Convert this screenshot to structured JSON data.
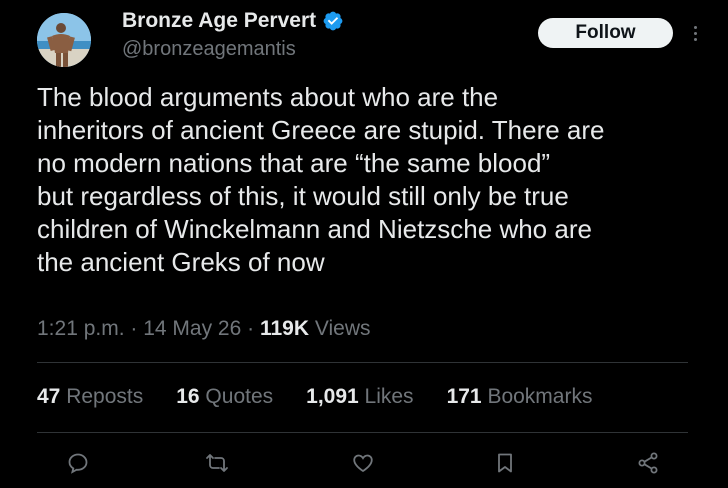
{
  "author": {
    "display_name": "Bronze Age Pervert",
    "handle": "@bronzeagemantis",
    "avatar_icon": "avatar-photo",
    "verified_icon": "verified-badge-icon",
    "verified_color": "#1d9bf0"
  },
  "header": {
    "follow_label": "Follow",
    "more_icon": "more-vertical-icon"
  },
  "tweet": {
    "text": "The blood arguments about who are the\ninheritors of ancient Greece are stupid. There are\nno modern nations that are “the same blood”\nbut regardless of this, it would still only be true\nchildren of Winckelmann and Nietzsche who are\nthe ancient Greks of now"
  },
  "meta": {
    "time": "1:21 p.m.",
    "separator": " · ",
    "date": "14 May 26",
    "views_count": "119K",
    "views_label": " Views"
  },
  "stats": {
    "reposts": {
      "count": "47",
      "label": " Reposts"
    },
    "quotes": {
      "count": "16",
      "label": " Quotes"
    },
    "likes": {
      "count": "1,091",
      "label": " Likes"
    },
    "bookmarks": {
      "count": "171",
      "label": " Bookmarks"
    }
  },
  "actions": {
    "reply_icon": "reply-icon",
    "repost_icon": "repost-icon",
    "like_icon": "heart-icon",
    "bookmark_icon": "bookmark-icon",
    "share_icon": "share-icon",
    "icon_color": "#71767b"
  }
}
